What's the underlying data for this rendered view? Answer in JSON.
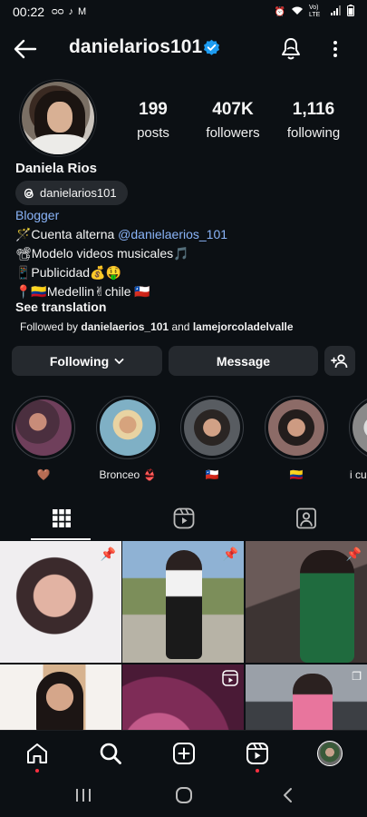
{
  "status_bar": {
    "time": "00:22",
    "left_icons": [
      "voicemail-icon",
      "tiktok-icon",
      "gmail-icon"
    ],
    "right_icons": [
      "alarm-icon",
      "wifi-icon",
      "volte-icon",
      "signal-icon",
      "battery-icon"
    ],
    "network_text": "Vo) LTE"
  },
  "header": {
    "username": "danielarios101"
  },
  "profile": {
    "stats": [
      {
        "value": "199",
        "label": "posts"
      },
      {
        "value": "407K",
        "label": "followers"
      },
      {
        "value": "1,116",
        "label": "following"
      }
    ],
    "display_name": "Daniela Rios",
    "threads_handle": "danielarios101",
    "category": "Blogger",
    "bio": {
      "line1_prefix": "🪄Cuenta alterna ",
      "line1_mention": "@danielaerios_101",
      "line2": "📽Modelo videos musicales🎵",
      "line3": "📱Publicidad💰🤑",
      "line4": "📍🇨🇴Medellin✌chile 🇨🇱"
    },
    "see_translation": "See translation",
    "followed_by": {
      "prefix": "Followed by ",
      "user1": "danielaerios_101",
      "joiner": " and ",
      "user2": "lamejorcoladelvalle"
    }
  },
  "actions": {
    "following": "Following",
    "message": "Message"
  },
  "highlights": [
    {
      "label": "🤎"
    },
    {
      "label": "Bronceo 👙"
    },
    {
      "label": "🇨🇱"
    },
    {
      "label": "🇨🇴"
    },
    {
      "label": "Mi cu"
    }
  ],
  "tabs": [
    "grid-icon",
    "reels-icon",
    "tagged-icon"
  ],
  "bottom_nav": [
    "home-icon",
    "search-icon",
    "create-icon",
    "reels-icon",
    "profile-avatar"
  ],
  "colors": {
    "background": "#0c1014",
    "button": "#25292e",
    "link": "#8ab4f8",
    "verified": "#1d9bf0",
    "notification": "#ff3040"
  }
}
